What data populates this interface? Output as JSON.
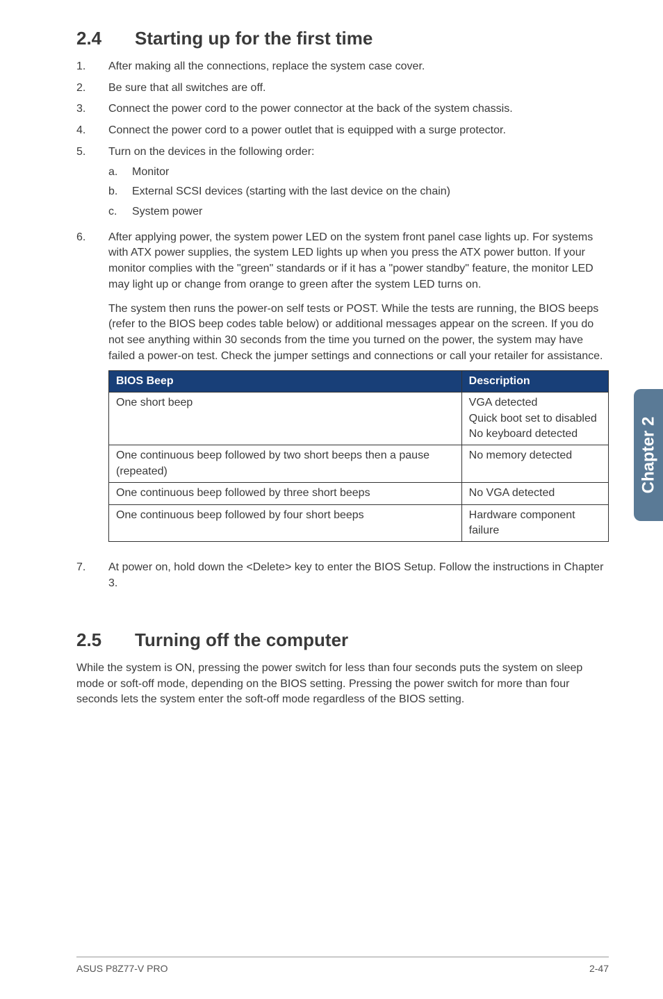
{
  "sideTab": "Chapter 2",
  "section24": {
    "num": "2.4",
    "title": "Starting up for the first time",
    "steps": [
      {
        "n": "1.",
        "text": "After making all the connections, replace the system case cover."
      },
      {
        "n": "2.",
        "text": "Be sure that all switches are off."
      },
      {
        "n": "3.",
        "text": "Connect the power cord to the power connector at the back of the system chassis."
      },
      {
        "n": "4.",
        "text": "Connect the power cord to a power outlet that is equipped with a surge protector."
      },
      {
        "n": "5.",
        "text": "Turn on the devices in the following order:",
        "sub": [
          {
            "m": "a.",
            "t": "Monitor"
          },
          {
            "m": "b.",
            "t": "External SCSI devices (starting with the last device on the chain)"
          },
          {
            "m": "c.",
            "t": "System power"
          }
        ]
      },
      {
        "n": "6.",
        "text": "After applying power, the system power LED on the system front panel case lights up. For systems with ATX power supplies, the system LED lights up when you press the ATX power button. If your monitor complies with the \"green\" standards or if it has a \"power standby\" feature, the monitor LED may light up or change from orange to green after the system LED turns on.",
        "para2": "The system then runs the power-on self tests or POST. While the tests are running, the BIOS beeps (refer to the BIOS beep codes table below) or additional messages appear on the screen. If you do not see anything within 30 seconds from the time you turned on the power, the system may have failed a power-on test. Check the jumper settings and connections or call your retailer for assistance."
      }
    ],
    "table": {
      "h1": "BIOS Beep",
      "h2": "Description",
      "rows": [
        {
          "c1": "One short beep",
          "c2": "VGA detected\nQuick boot set to disabled\nNo keyboard detected"
        },
        {
          "c1": "One continuous beep followed by two short beeps then a pause (repeated)",
          "c2": "No memory detected"
        },
        {
          "c1": "One continuous beep followed by three short beeps",
          "c2": "No VGA detected"
        },
        {
          "c1": "One continuous beep followed by four short beeps",
          "c2": "Hardware component failure"
        }
      ]
    },
    "step7": {
      "n": "7.",
      "text": "At power on, hold down the <Delete> key to enter the BIOS Setup. Follow the instructions in Chapter 3."
    }
  },
  "section25": {
    "num": "2.5",
    "title": "Turning off the computer",
    "body": "While the system is ON, pressing the power switch for less than four seconds puts the system on sleep mode or soft-off mode, depending on the BIOS setting. Pressing the power switch for more than four seconds lets the system enter the soft-off mode regardless of the BIOS setting."
  },
  "footer": {
    "left": "ASUS P8Z77-V PRO",
    "right": "2-47"
  }
}
